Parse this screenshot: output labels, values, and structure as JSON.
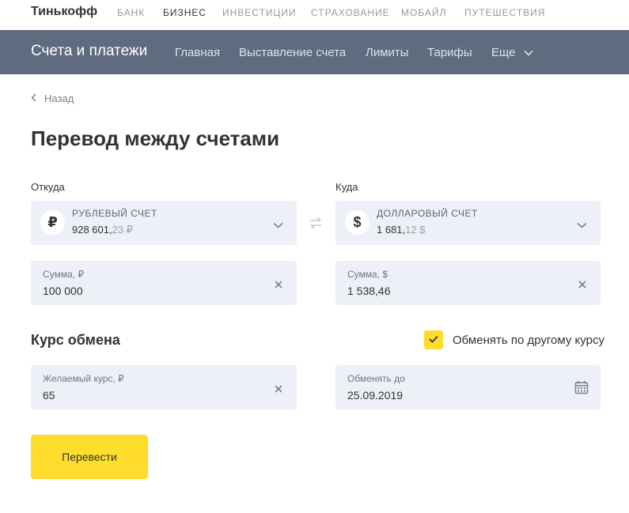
{
  "topnav": {
    "logo": "Тинькофф",
    "items": [
      "БАНК",
      "БИЗНЕС",
      "ИНВЕСТИЦИИ",
      "СТРАХОВАНИЕ",
      "МОБАЙЛ",
      "ПУТЕШЕСТВИЯ"
    ]
  },
  "subnav": {
    "title": "Счета и платежи",
    "items": [
      "Главная",
      "Выставление счета",
      "Лимиты",
      "Тарифы"
    ],
    "more_label": "Еще"
  },
  "back_label": "Назад",
  "page_title": "Перевод между счетами",
  "from": {
    "label": "Откуда",
    "account_icon": "₽",
    "account_name": "РУБЛЕВЫЙ СЧЕТ",
    "balance_int": "928 601,",
    "balance_dec": "23 ₽",
    "amount_label": "Сумма, ₽",
    "amount_value": "100 000"
  },
  "to": {
    "label": "Куда",
    "account_icon": "$",
    "account_name": "ДОЛЛАРОВЫЙ СЧЕТ",
    "balance_int": "1 681,",
    "balance_dec": "12 $",
    "amount_label": "Сумма, $",
    "amount_value": "1 538,46"
  },
  "exchange": {
    "title": "Курс обмена",
    "checkbox_label": "Обменять по другому курсу",
    "checkbox_checked": true,
    "rate_label": "Желаемый курс, ₽",
    "rate_value": "65",
    "until_label": "Обменять до",
    "until_value": "25.09.2019"
  },
  "submit_label": "Перевести",
  "colors": {
    "accent": "#ffdd2d",
    "subnav_bg": "#5f6b7f",
    "field_bg": "#edf0f6"
  }
}
